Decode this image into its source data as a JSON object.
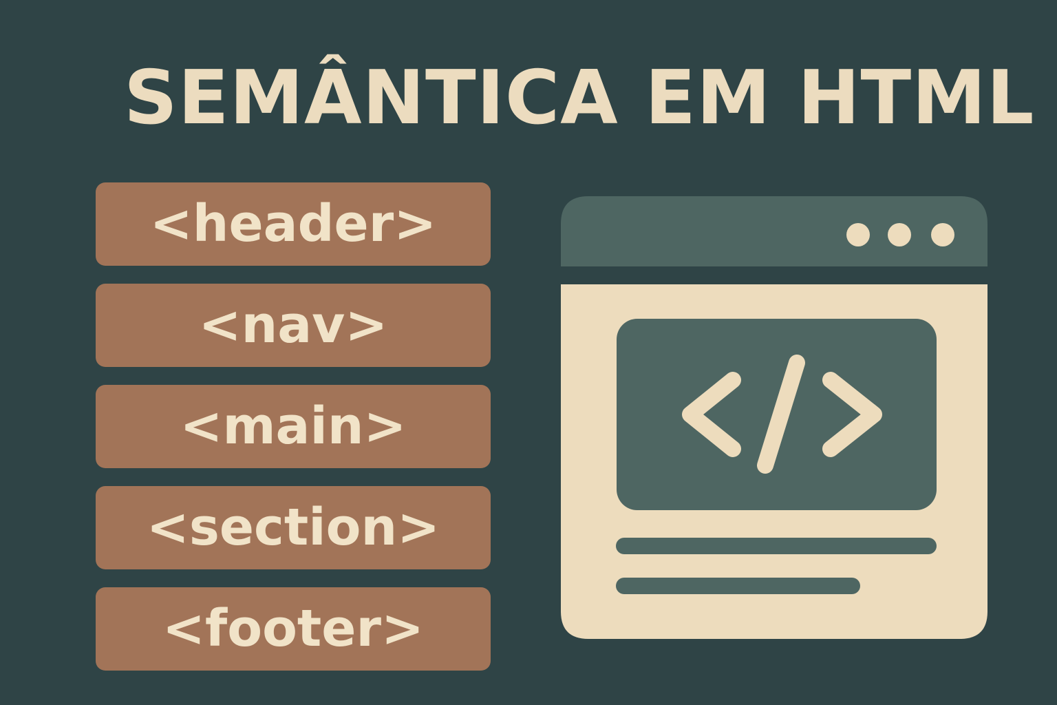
{
  "title": "SEMÂNTICA EM HTML",
  "tags": [
    "<header>",
    "<nav>",
    "<main>",
    "<section>",
    "<footer>"
  ],
  "colors": {
    "background": "#2f4446",
    "title_text": "#ecdcbf",
    "tag_bg": "#a27458",
    "tag_text": "#f1e3c8",
    "browser_header": "#4e6662",
    "browser_body": "#eddcbd",
    "code_panel": "#4e6662"
  },
  "icons": {
    "window_dots": "three-dots-icon",
    "code": "code-brackets-icon"
  }
}
